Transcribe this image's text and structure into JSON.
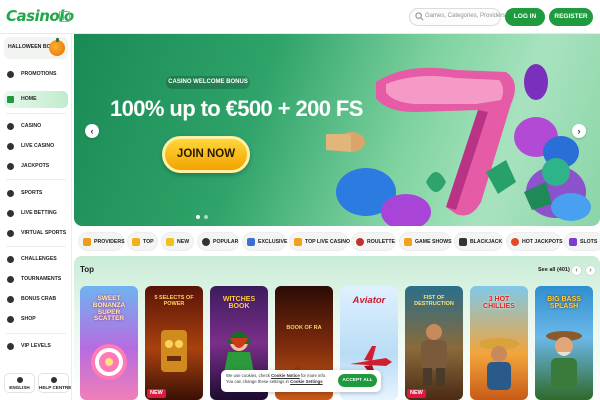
{
  "header": {
    "logo_text": "Casinolo",
    "search_placeholder": "Games, Categories, Providers",
    "login_label": "LOG IN",
    "register_label": "REGISTER"
  },
  "sidebar": {
    "promo_card": "HALLOWEEN BOOM",
    "items": [
      {
        "label": "PROMOTIONS",
        "icon": "gift-icon"
      },
      {
        "label": "HOME",
        "icon": "home-icon",
        "active": true
      },
      {
        "label": "CASINO",
        "icon": "cherry-icon"
      },
      {
        "label": "LIVE CASINO",
        "icon": "live-icon"
      },
      {
        "label": "JACKPOTS",
        "icon": "jackpot-icon"
      },
      {
        "label": "SPORTS",
        "icon": "ball-icon"
      },
      {
        "label": "LIVE BETTING",
        "icon": "live-betting-icon"
      },
      {
        "label": "VIRTUAL SPORTS",
        "icon": "virtual-icon"
      },
      {
        "label": "CHALLENGES",
        "icon": "challenge-icon"
      },
      {
        "label": "TOURNAMENTS",
        "icon": "trophy-icon"
      },
      {
        "label": "BONUS CRAB",
        "icon": "crab-icon"
      },
      {
        "label": "SHOP",
        "icon": "shop-icon"
      },
      {
        "label": "VIP LEVELS",
        "icon": "crown-icon"
      }
    ],
    "language_label": "ENGLISH",
    "help_label": "HELP CENTRE"
  },
  "hero": {
    "tag": "CASINO WELCOME BONUS",
    "title": "100% up to €500 + 200 FS",
    "cta": "JOIN NOW",
    "prev": "‹",
    "next": "›"
  },
  "categories": [
    {
      "label": "PROVIDERS",
      "color": "#f29a1c"
    },
    {
      "label": "TOP",
      "color": "#f2b01c"
    },
    {
      "label": "NEW",
      "color": "#f2c01c"
    },
    {
      "label": "POPULAR",
      "color": "#333333"
    },
    {
      "label": "EXCLUSIVE",
      "color": "#3b6fd8"
    },
    {
      "label": "TOP LIVE CASINO",
      "color": "#f2a11c"
    },
    {
      "label": "ROULETTE",
      "color": "#c23030"
    },
    {
      "label": "GAME SHOWS",
      "color": "#f2a11c"
    },
    {
      "label": "BLACKJACK",
      "color": "#333333"
    },
    {
      "label": "HOT JACKPOTS",
      "color": "#e04a2a"
    },
    {
      "label": "SLOTS",
      "color": "#7c3ad8"
    }
  ],
  "top_section": {
    "title": "Top",
    "see_all": "See all (401)",
    "prev": "‹",
    "next": "›",
    "games": [
      {
        "name": "SWEET BONANZA SUPER SCATTER",
        "new": false
      },
      {
        "name": "5 SELECTS OF POWER",
        "new": true
      },
      {
        "name": "WITCHES BOOK",
        "new": false
      },
      {
        "name": "BOOK OF RA",
        "new": false
      },
      {
        "name": "Aviator",
        "new": false
      },
      {
        "name": "FIST OF DESTRUCTION",
        "new": true
      },
      {
        "name": "3 HOT CHILLIES",
        "new": false
      },
      {
        "name": "BIG BASS SPLASH",
        "new": false
      }
    ],
    "new_badge": "NEW"
  },
  "cookie": {
    "text_1": "We use cookies, check ",
    "link_1": "Cookie Notice",
    "text_2": " for more info. You can change these settings in ",
    "link_2": "Cookie Settings",
    "accept": "ACCEPT ALL"
  },
  "colors": {
    "accent": "#1f9a3e",
    "hero_bg": "#2fa36a",
    "cta": "#f2a300"
  }
}
